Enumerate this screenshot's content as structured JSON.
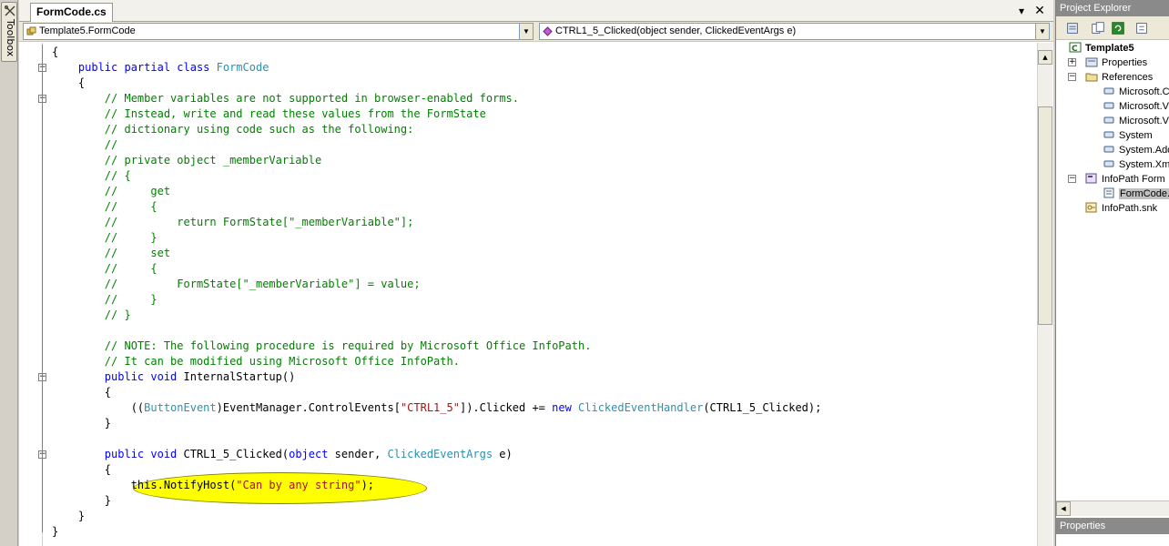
{
  "toolbox": {
    "label": "Toolbox"
  },
  "editor": {
    "tab": {
      "label": "FormCode.cs"
    },
    "type_combo": {
      "value": "Template5.FormCode"
    },
    "member_combo": {
      "value": "CTRL1_5_Clicked(object sender, ClickedEventArgs e)"
    },
    "code_lines": [
      {
        "indent": 0,
        "tokens": [
          {
            "t": "{",
            "c": ""
          }
        ]
      },
      {
        "indent": 1,
        "tokens": [
          {
            "t": "public partial class ",
            "c": "kw"
          },
          {
            "t": "FormCode",
            "c": "ty"
          }
        ]
      },
      {
        "indent": 1,
        "tokens": [
          {
            "t": "{",
            "c": ""
          }
        ]
      },
      {
        "indent": 2,
        "tokens": [
          {
            "t": "// Member variables are not supported in browser-enabled forms.",
            "c": "cm"
          }
        ]
      },
      {
        "indent": 2,
        "tokens": [
          {
            "t": "// Instead, write and read these values from the FormState",
            "c": "cm"
          }
        ]
      },
      {
        "indent": 2,
        "tokens": [
          {
            "t": "// dictionary using code such as the following:",
            "c": "cm"
          }
        ]
      },
      {
        "indent": 2,
        "tokens": [
          {
            "t": "//",
            "c": "cm"
          }
        ]
      },
      {
        "indent": 2,
        "tokens": [
          {
            "t": "// private object _memberVariable",
            "c": "cm"
          }
        ]
      },
      {
        "indent": 2,
        "tokens": [
          {
            "t": "// {",
            "c": "cm"
          }
        ]
      },
      {
        "indent": 2,
        "tokens": [
          {
            "t": "//     get",
            "c": "cm"
          }
        ]
      },
      {
        "indent": 2,
        "tokens": [
          {
            "t": "//     {",
            "c": "cm"
          }
        ]
      },
      {
        "indent": 2,
        "tokens": [
          {
            "t": "//         return FormState[\"_memberVariable\"];",
            "c": "cm"
          }
        ]
      },
      {
        "indent": 2,
        "tokens": [
          {
            "t": "//     }",
            "c": "cm"
          }
        ]
      },
      {
        "indent": 2,
        "tokens": [
          {
            "t": "//     set",
            "c": "cm"
          }
        ]
      },
      {
        "indent": 2,
        "tokens": [
          {
            "t": "//     {",
            "c": "cm"
          }
        ]
      },
      {
        "indent": 2,
        "tokens": [
          {
            "t": "//         FormState[\"_memberVariable\"] = value;",
            "c": "cm"
          }
        ]
      },
      {
        "indent": 2,
        "tokens": [
          {
            "t": "//     }",
            "c": "cm"
          }
        ]
      },
      {
        "indent": 2,
        "tokens": [
          {
            "t": "// }",
            "c": "cm"
          }
        ]
      },
      {
        "indent": 0,
        "tokens": []
      },
      {
        "indent": 2,
        "tokens": [
          {
            "t": "// NOTE: The following procedure is required by Microsoft Office InfoPath.",
            "c": "cm"
          }
        ]
      },
      {
        "indent": 2,
        "tokens": [
          {
            "t": "// It can be modified using Microsoft Office InfoPath.",
            "c": "cm"
          }
        ]
      },
      {
        "indent": 2,
        "tokens": [
          {
            "t": "public void ",
            "c": "kw"
          },
          {
            "t": "InternalStartup()",
            "c": ""
          }
        ]
      },
      {
        "indent": 2,
        "tokens": [
          {
            "t": "{",
            "c": ""
          }
        ]
      },
      {
        "indent": 3,
        "tokens": [
          {
            "t": "((",
            "c": ""
          },
          {
            "t": "ButtonEvent",
            "c": "ty"
          },
          {
            "t": ")EventManager.ControlEvents[",
            "c": ""
          },
          {
            "t": "\"CTRL1_5\"",
            "c": "st"
          },
          {
            "t": "]).Clicked += ",
            "c": ""
          },
          {
            "t": "new ",
            "c": "kw"
          },
          {
            "t": "ClickedEventHandler",
            "c": "ty"
          },
          {
            "t": "(CTRL1_5_Clicked);",
            "c": ""
          }
        ]
      },
      {
        "indent": 2,
        "tokens": [
          {
            "t": "}",
            "c": ""
          }
        ]
      },
      {
        "indent": 0,
        "tokens": []
      },
      {
        "indent": 2,
        "tokens": [
          {
            "t": "public void ",
            "c": "kw"
          },
          {
            "t": "CTRL1_5_Clicked(",
            "c": ""
          },
          {
            "t": "object",
            "c": "kw"
          },
          {
            "t": " sender, ",
            "c": ""
          },
          {
            "t": "ClickedEventArgs",
            "c": "ty"
          },
          {
            "t": " e)",
            "c": ""
          }
        ]
      },
      {
        "indent": 2,
        "tokens": [
          {
            "t": "{",
            "c": ""
          }
        ]
      },
      {
        "indent": 3,
        "tokens": [
          {
            "t": "this.NotifyHost(",
            "c": ""
          },
          {
            "t": "\"Can by any string\"",
            "c": "st"
          },
          {
            "t": ");",
            "c": ""
          }
        ]
      },
      {
        "indent": 2,
        "tokens": [
          {
            "t": "}",
            "c": ""
          }
        ]
      },
      {
        "indent": 1,
        "tokens": [
          {
            "t": "}",
            "c": ""
          }
        ]
      },
      {
        "indent": 0,
        "tokens": [
          {
            "t": "}",
            "c": ""
          }
        ]
      }
    ]
  },
  "project_explorer": {
    "title": "Project Explorer",
    "items": [
      {
        "label": "Template5",
        "icon": "csharp-project-icon"
      },
      {
        "label": "Properties",
        "icon": "properties-icon"
      },
      {
        "label": "References",
        "icon": "references-folder-icon"
      },
      {
        "label": "Microsoft.C",
        "icon": "reference-icon"
      },
      {
        "label": "Microsoft.V",
        "icon": "reference-icon"
      },
      {
        "label": "Microsoft.V",
        "icon": "reference-icon"
      },
      {
        "label": "System",
        "icon": "reference-icon"
      },
      {
        "label": "System.Ado",
        "icon": "reference-icon"
      },
      {
        "label": "System.Xm",
        "icon": "reference-icon"
      },
      {
        "label": "InfoPath Form",
        "icon": "infopath-form-icon"
      },
      {
        "label": "FormCode.",
        "icon": "code-file-icon"
      },
      {
        "label": "InfoPath.snk",
        "icon": "key-file-icon"
      }
    ]
  },
  "properties_panel": {
    "title": "Properties"
  },
  "colors": {
    "keyword": "#0000ff",
    "type": "#2b91af",
    "comment": "#008000",
    "string": "#a31515",
    "highlight": "#ffff00"
  }
}
